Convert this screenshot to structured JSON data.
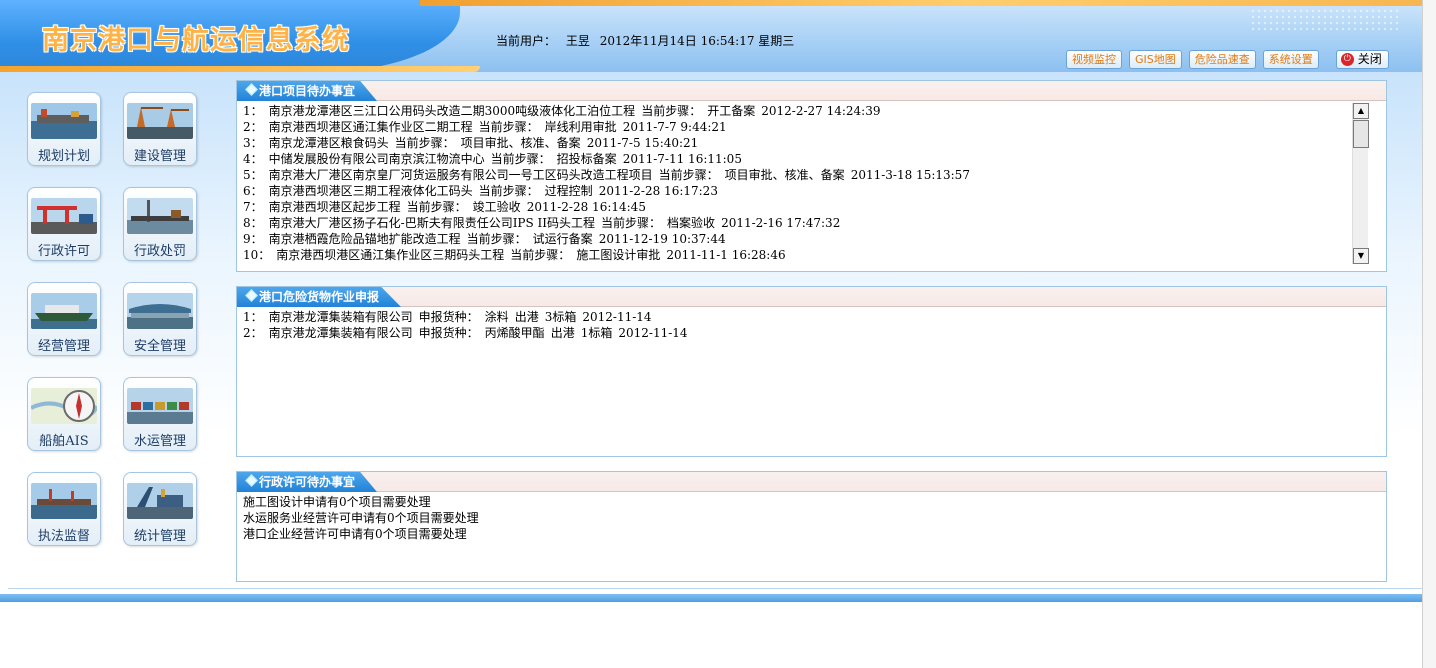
{
  "header": {
    "app_title": "南京港口与航运信息系统",
    "current_user_label": "当前用户：",
    "current_user": "王昱",
    "datetime": "2012年11月14日  16:54:17 星期三"
  },
  "toolbar": {
    "buttons": [
      "视频监控",
      "GIS地图",
      "危险品速查",
      "系统设置"
    ],
    "close_label": "关闭"
  },
  "nav": {
    "items": [
      {
        "label": "规划计划",
        "icon": "port-planning-icon"
      },
      {
        "label": "建设管理",
        "icon": "construction-crane-icon"
      },
      {
        "label": "行政许可",
        "icon": "port-crane-icon"
      },
      {
        "label": "行政处罚",
        "icon": "pier-icon"
      },
      {
        "label": "经营管理",
        "icon": "ship-icon"
      },
      {
        "label": "安全管理",
        "icon": "ferry-terminal-icon"
      },
      {
        "label": "船舶AIS",
        "icon": "compass-map-icon"
      },
      {
        "label": "水运管理",
        "icon": "container-yard-icon"
      },
      {
        "label": "执法监督",
        "icon": "harbor-icon"
      },
      {
        "label": "统计管理",
        "icon": "dock-machinery-icon"
      }
    ]
  },
  "panels": {
    "projects": {
      "title": "港口项目待办事宜",
      "rows": [
        {
          "num": "1：",
          "name": "南京港龙潭港区三江口公用码头改造二期3000吨级液体化工泊位工程",
          "step_label": "当前步骤：",
          "step": "开工备案",
          "time": "2012-2-27 14:24:39"
        },
        {
          "num": "2：",
          "name": "南京港西坝港区通江集作业区二期工程",
          "step_label": "当前步骤：",
          "step": "岸线利用审批",
          "time": "2011-7-7 9:44:21"
        },
        {
          "num": "3：",
          "name": "南京龙潭港区粮食码头",
          "step_label": "当前步骤：",
          "step": "项目审批、核准、备案",
          "time": "2011-7-5 15:40:21"
        },
        {
          "num": "4：",
          "name": "中储发展股份有限公司南京滨江物流中心",
          "step_label": "当前步骤：",
          "step": "招投标备案",
          "time": "2011-7-11 16:11:05"
        },
        {
          "num": "5：",
          "name": "南京港大厂港区南京皇厂河货运服务有限公司一号工区码头改造工程项目",
          "step_label": "当前步骤：",
          "step": "项目审批、核准、备案",
          "time": "2011-3-18 15:13:57"
        },
        {
          "num": "6：",
          "name": "南京港西坝港区三期工程液体化工码头",
          "step_label": "当前步骤：",
          "step": "过程控制",
          "time": "2011-2-28 16:17:23"
        },
        {
          "num": "7：",
          "name": "南京港西坝港区起步工程",
          "step_label": "当前步骤：",
          "step": "竣工验收",
          "time": "2011-2-28 16:14:45"
        },
        {
          "num": "8：",
          "name": "南京港大厂港区扬子石化-巴斯夫有限责任公司IPS II码头工程",
          "step_label": "当前步骤：",
          "step": "档案验收",
          "time": "2011-2-16 17:47:32"
        },
        {
          "num": "9：",
          "name": "南京港栖霞危险品锚地扩能改造工程",
          "step_label": "当前步骤：",
          "step": "试运行备案",
          "time": "2011-12-19 10:37:44"
        },
        {
          "num": "10：",
          "name": "南京港西坝港区通江集作业区三期码头工程",
          "step_label": "当前步骤：",
          "step": "施工图设计审批",
          "time": "2011-11-1 16:28:46"
        }
      ]
    },
    "dangerous": {
      "title": "港口危险货物作业申报",
      "rows": [
        {
          "num": "1：",
          "company": "南京港龙潭集装箱有限公司",
          "cargo_label": "申报货种：",
          "cargo": "涂料",
          "direction": "出港",
          "qty": "3标箱",
          "date": "2012-11-14"
        },
        {
          "num": "2：",
          "company": "南京港龙潭集装箱有限公司",
          "cargo_label": "申报货种：",
          "cargo": "丙烯酸甲酯",
          "direction": "出港",
          "qty": "1标箱",
          "date": "2012-11-14"
        }
      ]
    },
    "admin": {
      "title": "行政许可待办事宜",
      "rows": [
        "施工图设计申请有0个项目需要处理",
        "水运服务业经营许可申请有0个项目需要处理",
        "港口企业经营许可申请有0个项目需要处理"
      ]
    }
  },
  "colors": {
    "header_blue": "#2f8fe6",
    "title_orange": "#ffb347",
    "panel_tab_blue": "#2282d8",
    "toolbar_text": "#e07a10",
    "close_red": "#d9262a"
  }
}
